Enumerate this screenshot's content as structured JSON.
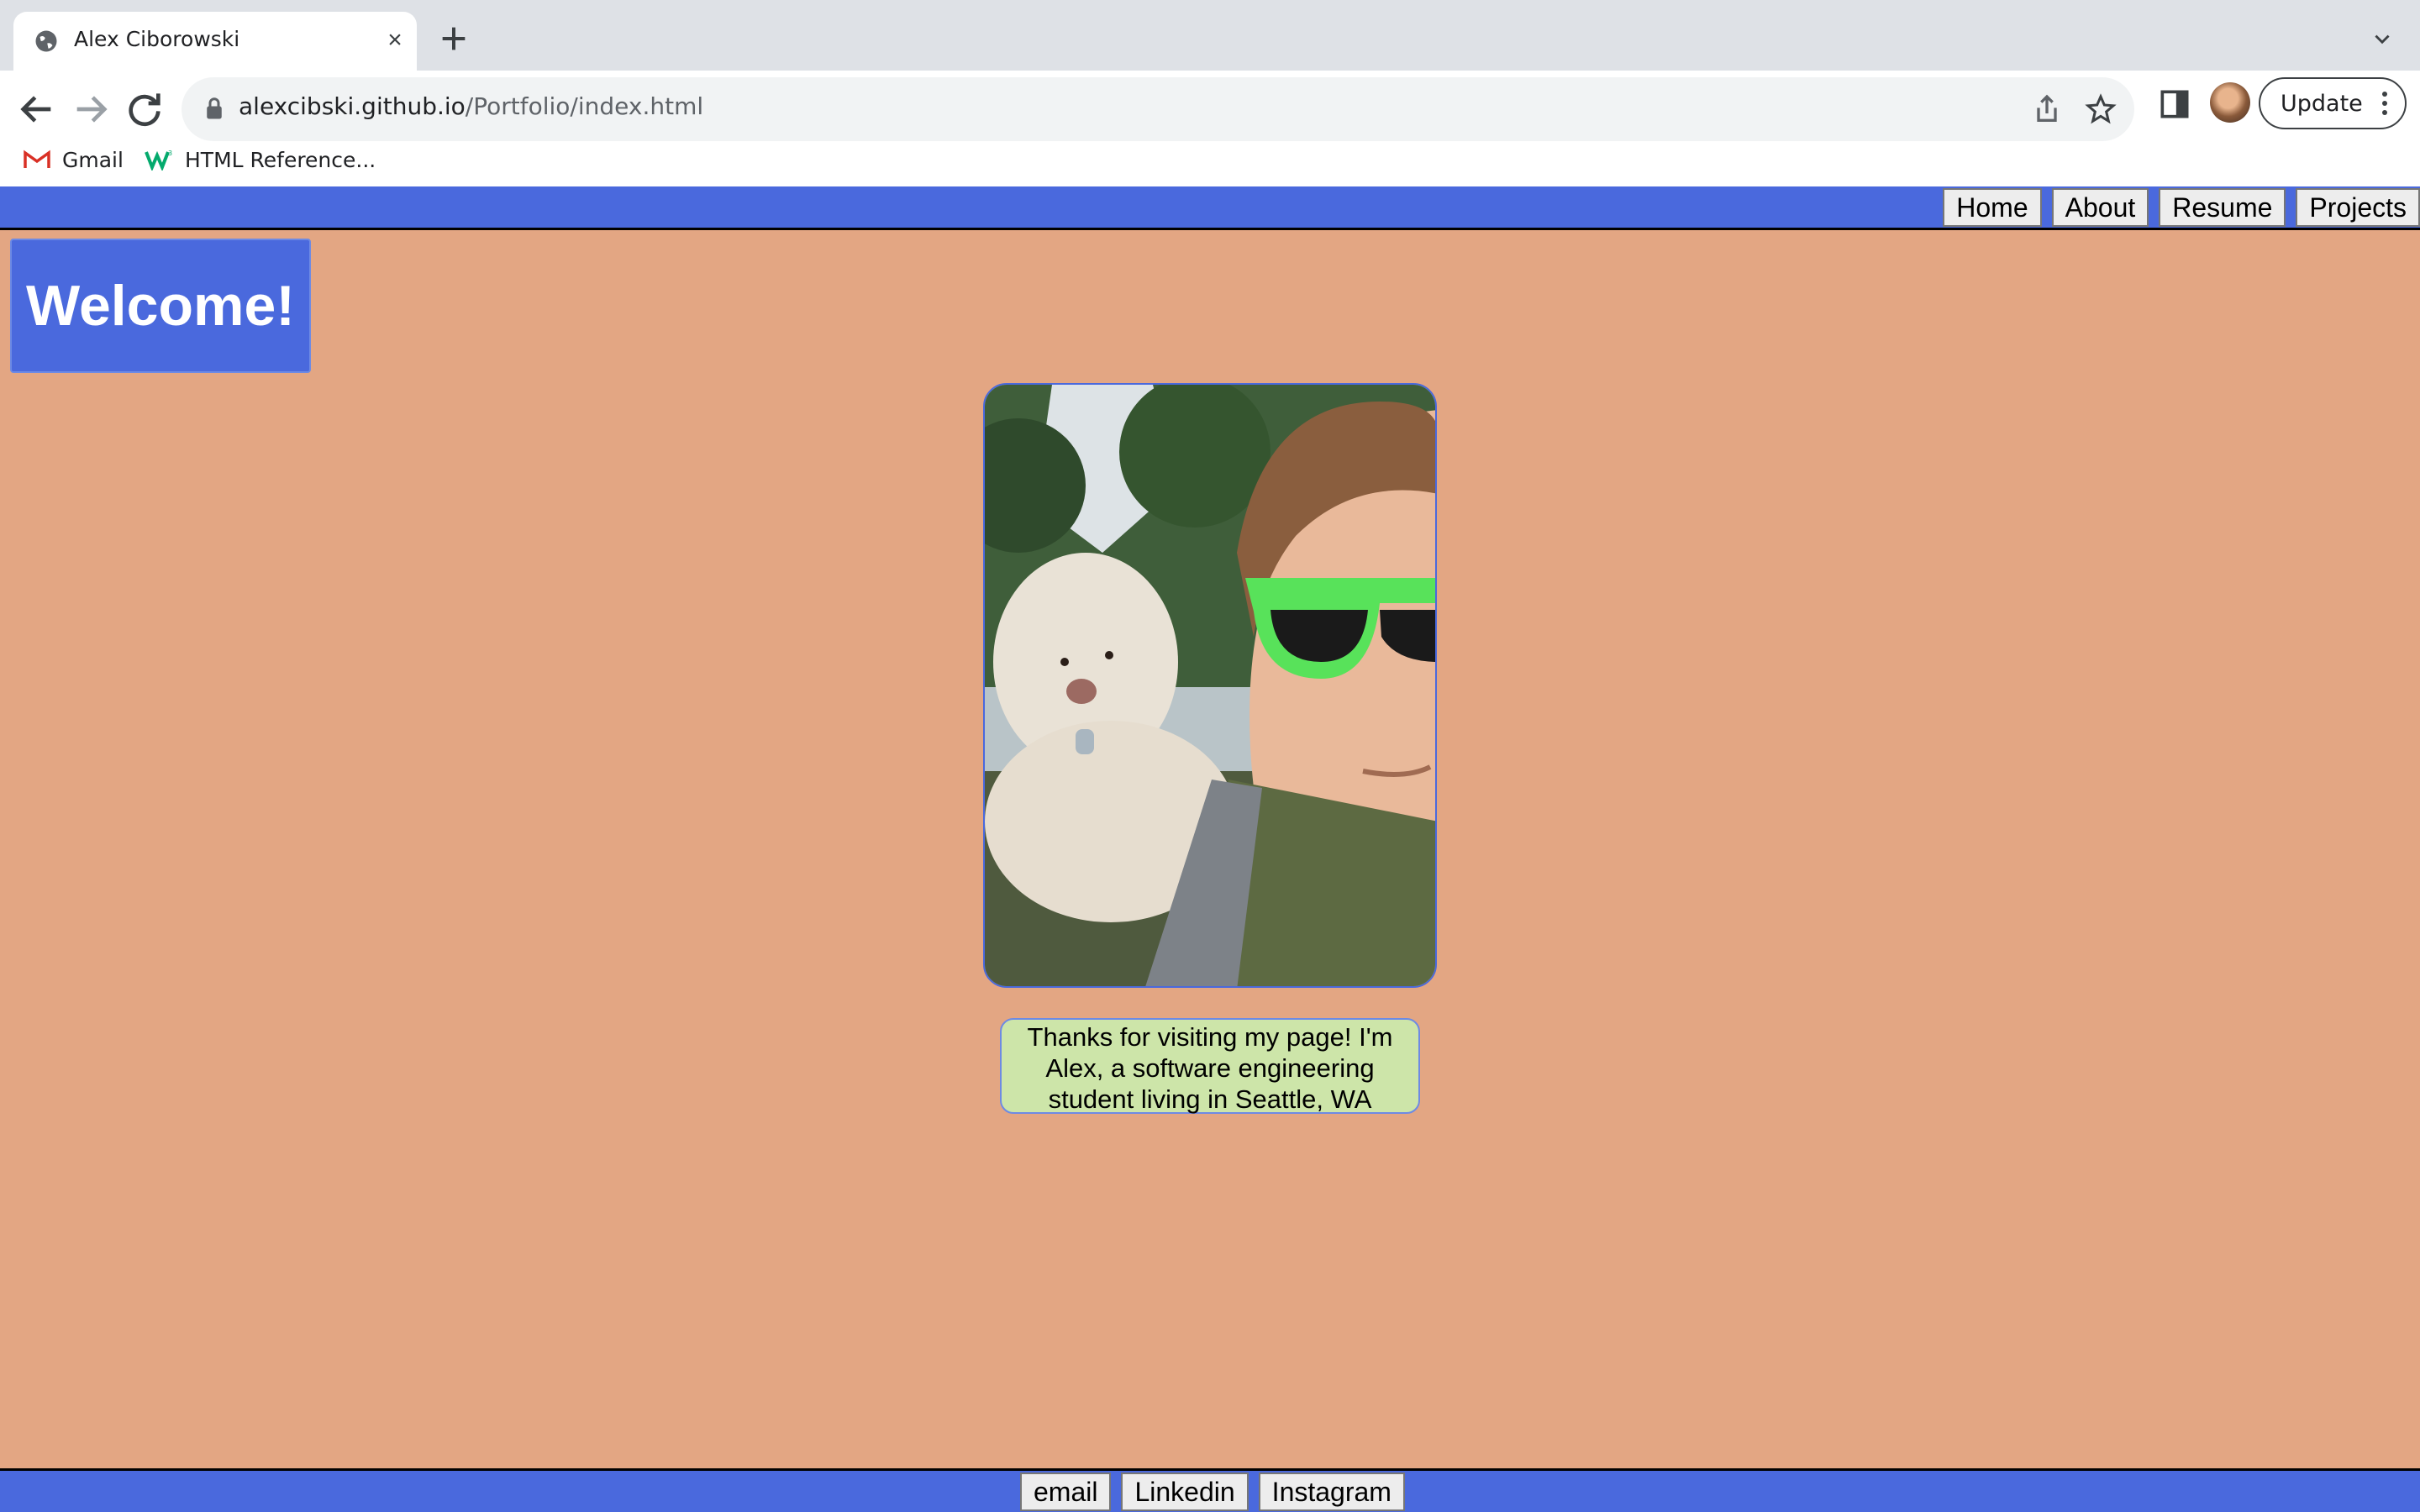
{
  "browser": {
    "tab_title": "Alex Ciborowski",
    "url_host": "alexcibski.github.io",
    "url_path": "/Portfolio/index.html",
    "update_label": "Update",
    "bookmarks": [
      {
        "label": "Gmail",
        "icon": "gmail-icon"
      },
      {
        "label": "HTML Reference...",
        "icon": "w3-icon"
      }
    ]
  },
  "nav": {
    "links": [
      "Home",
      "About",
      "Resume",
      "Projects"
    ]
  },
  "main": {
    "welcome": "Welcome!",
    "photo_alt": "selfie with dog",
    "intro_line1": "Thanks for visiting my page! I'm",
    "intro_line2": "Alex, a software engineering",
    "intro_line3": "student living in Seattle, WA"
  },
  "footer": {
    "links": [
      "email",
      "Linkedin",
      "Instagram"
    ]
  },
  "colors": {
    "page_bg": "#e3a683",
    "bar_blue": "#4a69dd",
    "intro_bg": "#cde5a9"
  }
}
